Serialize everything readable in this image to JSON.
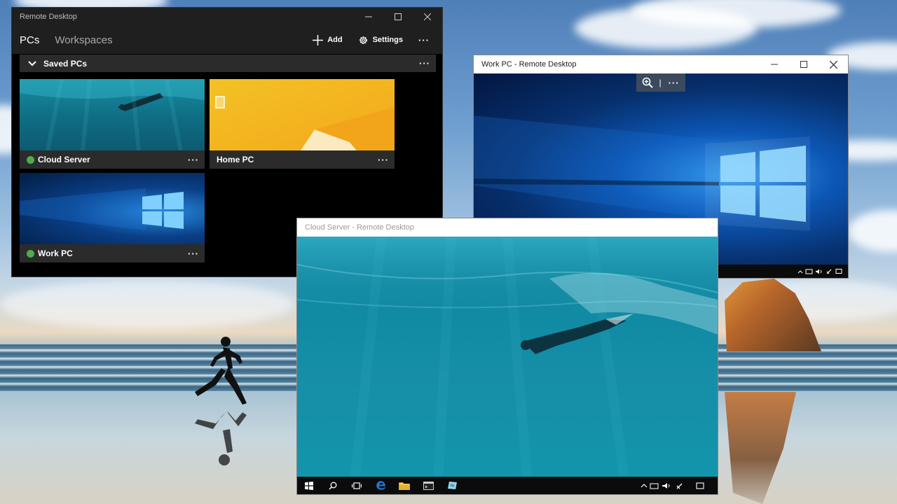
{
  "main_app": {
    "title": "Remote Desktop",
    "tabs": [
      {
        "label": "PCs",
        "active": true
      },
      {
        "label": "Workspaces",
        "active": false
      }
    ],
    "actions": {
      "add_label": "Add",
      "settings_label": "Settings",
      "more_label": "···"
    },
    "group": {
      "label": "Saved PCs",
      "more_label": "···"
    },
    "pcs": [
      {
        "name": "Cloud Server",
        "status_color": "#4cae4c",
        "thumbnail": "underwater",
        "more_label": "···"
      },
      {
        "name": "Home PC",
        "thumbnail": "windows-8-yellow",
        "more_label": "···"
      },
      {
        "name": "Work PC",
        "status_color": "#4cae4c",
        "thumbnail": "windows-10",
        "more_label": "···"
      }
    ]
  },
  "work_window": {
    "title": "Work PC - Remote Desktop",
    "zoom_bar": {
      "separator": "|",
      "more_label": "···"
    }
  },
  "cloud_window": {
    "title": "Cloud Server - Remote Desktop"
  },
  "icons": {
    "window_minimize": "minimize-icon",
    "window_maximize": "maximize-icon",
    "window_close": "close-icon",
    "add": "plus-icon",
    "settings": "gear-icon",
    "group_toggle": "chevron-down-icon",
    "zoom": "zoom-in-icon"
  },
  "colors": {
    "app_bg": "#000000",
    "app_chrome": "#1f1f1f",
    "tile_label_bg": "#2b2b2b",
    "online": "#4cae4c",
    "edge_blue": "#1f7ad8"
  }
}
